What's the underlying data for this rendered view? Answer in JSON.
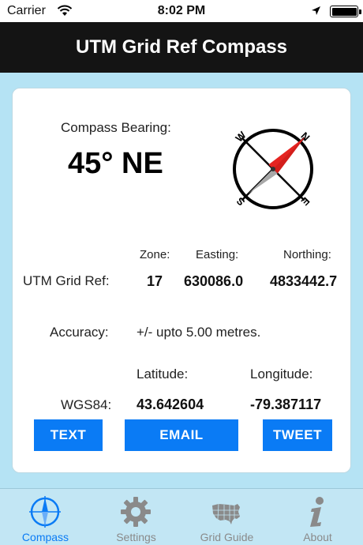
{
  "status_bar": {
    "carrier": "Carrier",
    "time": "8:02 PM"
  },
  "nav": {
    "title": "UTM Grid Ref Compass"
  },
  "compass": {
    "label": "Compass Bearing:",
    "bearing": "45° NE",
    "bearing_degrees": 45,
    "letters": {
      "n": "N",
      "e": "E",
      "s": "S",
      "w": "W"
    },
    "needle_north_color": "#e52421",
    "needle_south_color": "#a8a8a8"
  },
  "utm": {
    "label": "UTM Grid Ref:",
    "zone_header": "Zone:",
    "easting_header": "Easting:",
    "northing_header": "Northing:",
    "zone": "17",
    "easting": "630086.0",
    "northing": "4833442.7"
  },
  "accuracy": {
    "label": "Accuracy:",
    "value": "+/- upto 5.00 metres."
  },
  "wgs84": {
    "label": "WGS84:",
    "latitude_header": "Latitude:",
    "longitude_header": "Longitude:",
    "latitude": "43.642604",
    "longitude": "-79.387117"
  },
  "buttons": {
    "text": "TEXT",
    "email": "EMAIL",
    "tweet": "TWEET"
  },
  "tabs": [
    {
      "label": "Compass",
      "icon": "compass-icon",
      "active": true
    },
    {
      "label": "Settings",
      "icon": "gear-icon",
      "active": false
    },
    {
      "label": "Grid Guide",
      "icon": "usa-map-icon",
      "active": false
    },
    {
      "label": "About",
      "icon": "info-icon",
      "active": false
    }
  ],
  "colors": {
    "accent": "#0a7bf5",
    "background": "#b5e3f4",
    "nav_background": "#141414"
  }
}
